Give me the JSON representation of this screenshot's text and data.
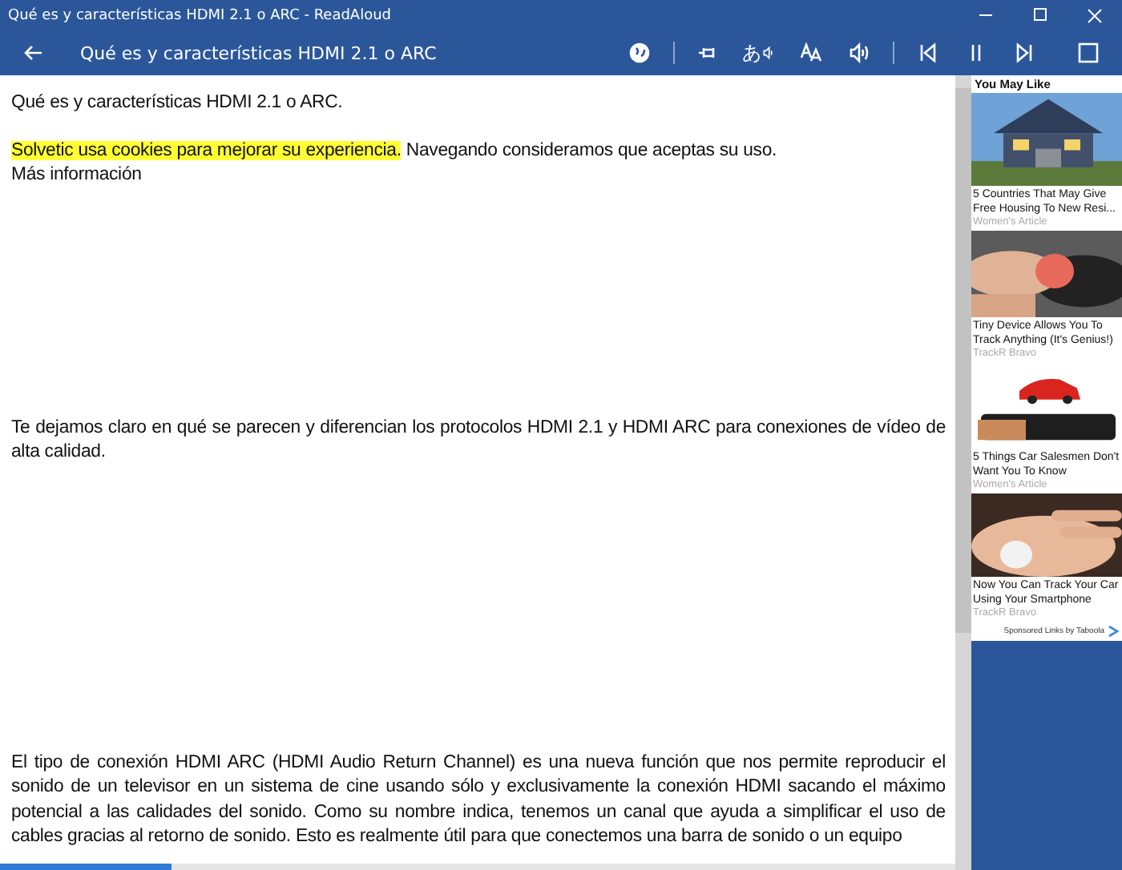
{
  "window": {
    "title": "Qué es y características HDMI 2.1 o ARC - ReadAloud"
  },
  "toolbar": {
    "title": "Qué es y características HDMI 2.1 o ARC",
    "language_glyph": "あ"
  },
  "article": {
    "paragraphs": [
      {
        "kind": "title",
        "text": "Qué es y características HDMI 2.1 o ARC."
      },
      {
        "kind": "cookie",
        "highlight": "Solvetic usa cookies para mejorar su experiencia.",
        "text": " Navegando consideramos que aceptas su uso.",
        "link": "Más información"
      },
      {
        "kind": "body",
        "text": "Te dejamos claro en qué se parecen y diferencian los protocolos HDMI 2.1 y HDMI ARC para conexiones de vídeo de alta calidad."
      },
      {
        "kind": "body",
        "text": "El tipo de conexión HDMI ARC (HDMI Audio Return Channel) es una nueva función que nos permite reproducir el sonido de un televisor en un sistema de cine usando sólo y exclusivamente la conexión HDMI sacando el máximo potencial a las calidades del sonido. Como su nombre indica, tenemos un canal que ayuda a simplificar el uso de cables gracias al retorno de sonido. Esto es realmente útil para que conectemos una barra de sonido o un equipo"
      }
    ]
  },
  "progress": {
    "level": 0.18
  },
  "ads": {
    "heading": "You May Like",
    "items": [
      {
        "title": "5 Countries That May Give Free Housing To New Resi...",
        "source": "Women's Article"
      },
      {
        "title": "Tiny Device Allows You To Track Anything (It's Genius!)",
        "source": "TrackR Bravo"
      },
      {
        "title": "5 Things Car Salesmen Don't Want You To Know",
        "source": "Women's Article"
      },
      {
        "title": "Now You Can Track Your Car Using Your Smartphone",
        "source": "TrackR Bravo"
      }
    ],
    "sponsor": "Sponsored Links by Taboola"
  }
}
